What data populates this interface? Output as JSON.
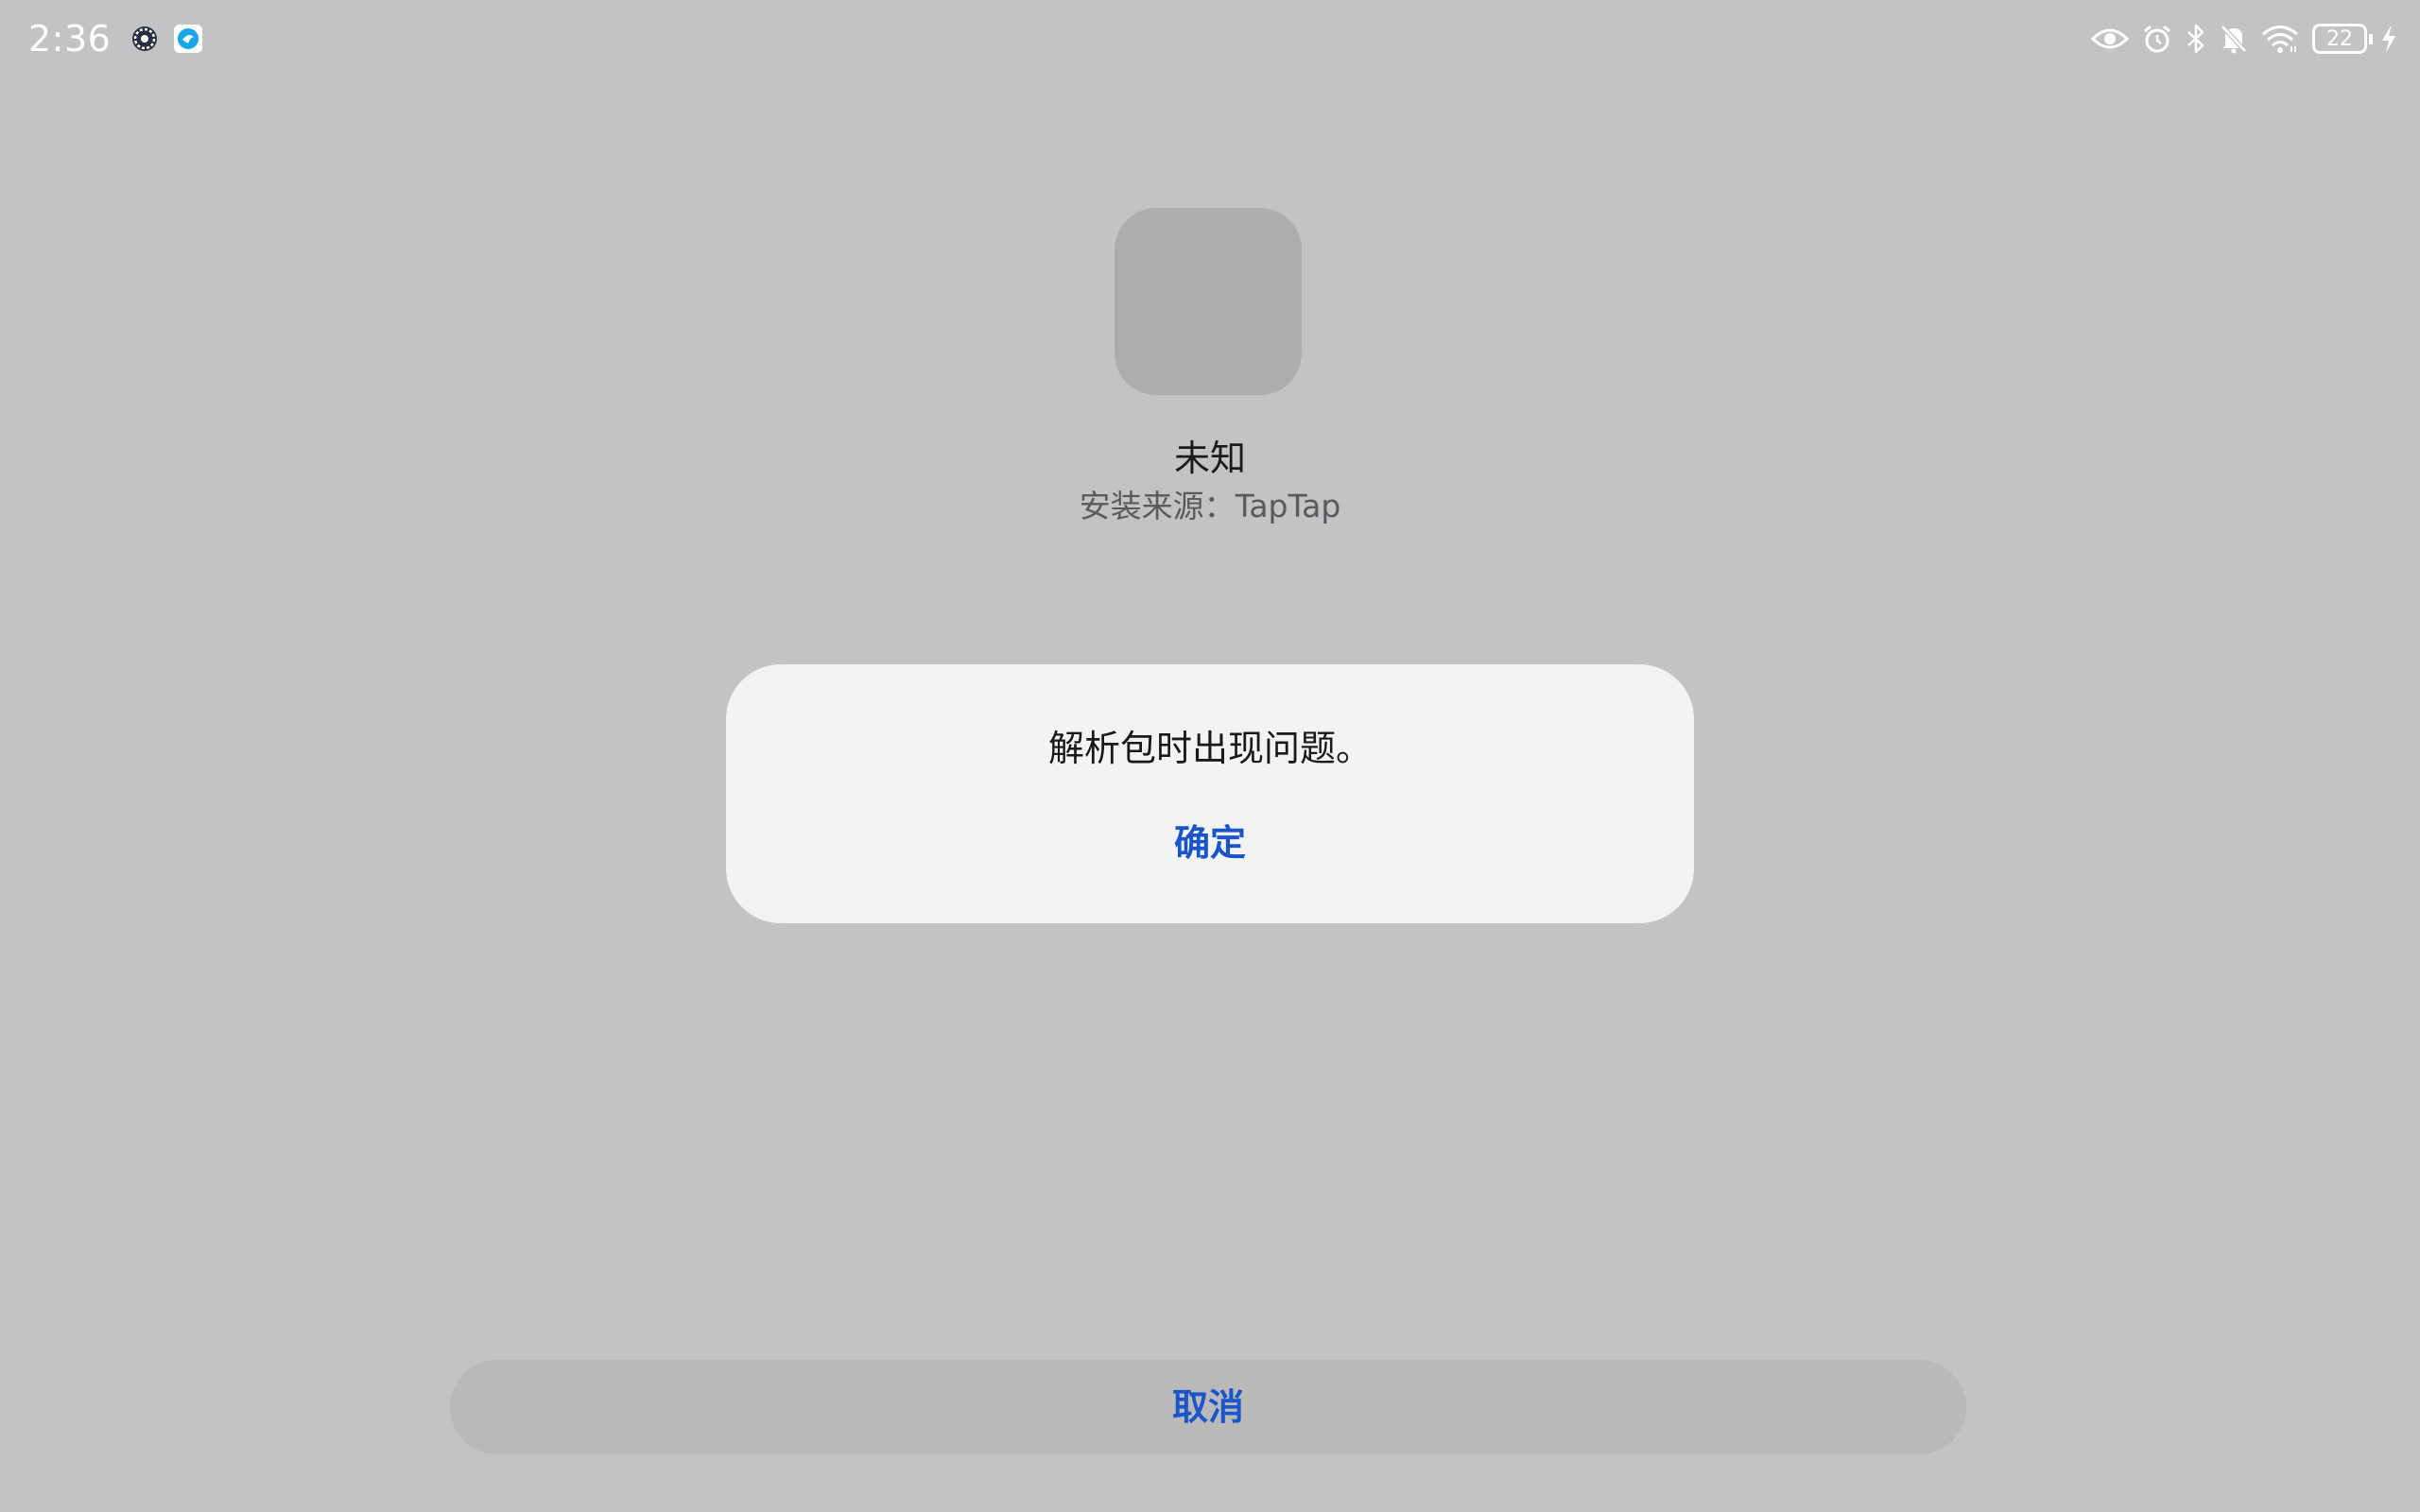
{
  "status_bar": {
    "time": "2:36",
    "notification_icons": [
      "settings-gear-icon",
      "taptap-app-icon"
    ],
    "system_icons": [
      "eye-icon",
      "alarm-icon",
      "bluetooth-icon",
      "mute-icon",
      "wifi-icon",
      "battery-icon",
      "charging-icon"
    ],
    "battery_level": "22"
  },
  "app": {
    "name": "未知",
    "install_source": "安装来源：TapTap"
  },
  "dialog": {
    "message": "解析包时出现问题。",
    "confirm_label": "确定"
  },
  "footer": {
    "cancel_label": "取消"
  },
  "colors": {
    "background": "#c2c3c5",
    "accent": "#1a56c9",
    "dialog_bg": "#f2f3f3",
    "icon_placeholder": "#acadaf"
  }
}
